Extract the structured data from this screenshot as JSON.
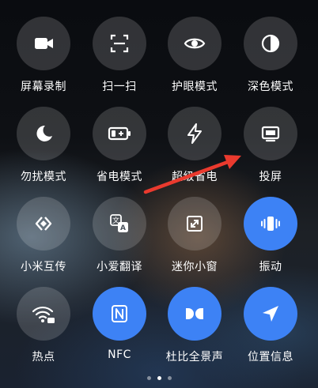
{
  "tiles": [
    {
      "label": "屏幕录制",
      "icon": "video-camera-icon",
      "active": false
    },
    {
      "label": "扫一扫",
      "icon": "scan-icon",
      "active": false
    },
    {
      "label": "护眼模式",
      "icon": "eye-icon",
      "active": false
    },
    {
      "label": "深色模式",
      "icon": "dark-mode-icon",
      "active": false
    },
    {
      "label": "勿扰模式",
      "icon": "moon-icon",
      "active": false
    },
    {
      "label": "省电模式",
      "icon": "battery-icon",
      "active": false
    },
    {
      "label": "超级省电",
      "icon": "lightning-icon",
      "active": false
    },
    {
      "label": "投屏",
      "icon": "screen-cast-icon",
      "active": false
    },
    {
      "label": "小米互传",
      "icon": "mi-share-icon",
      "active": false
    },
    {
      "label": "小爱翻译",
      "icon": "translate-icon",
      "active": false
    },
    {
      "label": "迷你小窗",
      "icon": "mini-window-icon",
      "active": false
    },
    {
      "label": "振动",
      "icon": "vibrate-icon",
      "active": true
    },
    {
      "label": "热点",
      "icon": "hotspot-icon",
      "active": false
    },
    {
      "label": "NFC",
      "icon": "nfc-icon",
      "active": true
    },
    {
      "label": "杜比全景声",
      "icon": "dolby-icon",
      "active": true
    },
    {
      "label": "位置信息",
      "icon": "location-icon",
      "active": true
    }
  ],
  "pager": {
    "pages": 3,
    "current": 2
  },
  "colors": {
    "active": "#3d82f5",
    "annotation_arrow": "#ea3a2e"
  }
}
